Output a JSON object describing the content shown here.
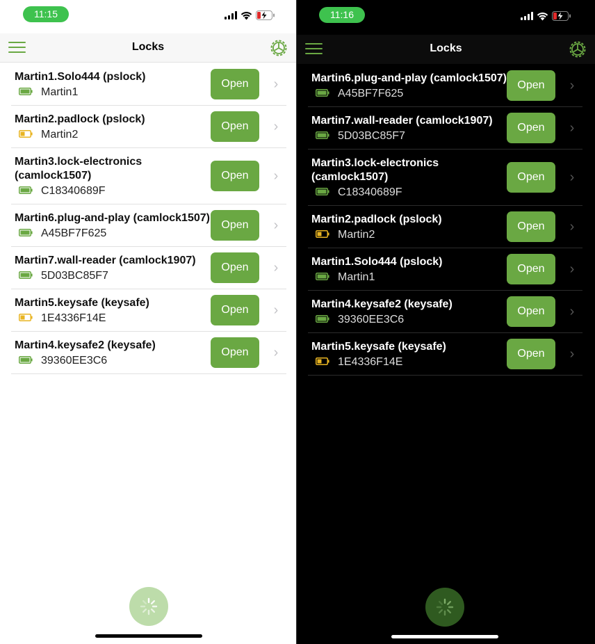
{
  "colors": {
    "accent": "#6aa843",
    "battery_ok": "#6aa843",
    "battery_low": "#e8b422",
    "time_pill": "#3ec24e"
  },
  "light": {
    "status": {
      "time": "11:15"
    },
    "nav": {
      "title": "Locks",
      "menu_icon": "hamburger-menu-icon",
      "settings_icon": "gear-icon"
    },
    "locks": [
      {
        "name": "Martin1.Solo444 (pslock)",
        "subtitle": "Martin1",
        "battery": "ok",
        "action": "Open"
      },
      {
        "name": "Martin2.padlock (pslock)",
        "subtitle": "Martin2",
        "battery": "low",
        "action": "Open"
      },
      {
        "name": "Martin3.lock-electronics (camlock1507)",
        "subtitle": "C18340689F",
        "battery": "ok",
        "action": "Open"
      },
      {
        "name": "Martin6.plug-and-play (camlock1507)",
        "subtitle": "A45BF7F625",
        "battery": "ok",
        "action": "Open"
      },
      {
        "name": "Martin7.wall-reader (camlock1907)",
        "subtitle": "5D03BC85F7",
        "battery": "ok",
        "action": "Open"
      },
      {
        "name": "Martin5.keysafe (keysafe)",
        "subtitle": "1E4336F14E",
        "battery": "low",
        "action": "Open"
      },
      {
        "name": "Martin4.keysafe2 (keysafe)",
        "subtitle": "39360EE3C6",
        "battery": "ok",
        "action": "Open"
      }
    ]
  },
  "dark": {
    "status": {
      "time": "11:16"
    },
    "nav": {
      "title": "Locks",
      "menu_icon": "hamburger-menu-icon",
      "settings_icon": "gear-icon"
    },
    "locks": [
      {
        "name": "Martin6.plug-and-play (camlock1507)",
        "subtitle": "A45BF7F625",
        "battery": "ok",
        "action": "Open"
      },
      {
        "name": "Martin7.wall-reader (camlock1907)",
        "subtitle": "5D03BC85F7",
        "battery": "ok",
        "action": "Open"
      },
      {
        "name": "Martin3.lock-electronics (camlock1507)",
        "subtitle": "C18340689F",
        "battery": "ok",
        "action": "Open"
      },
      {
        "name": "Martin2.padlock (pslock)",
        "subtitle": "Martin2",
        "battery": "low",
        "action": "Open"
      },
      {
        "name": "Martin1.Solo444 (pslock)",
        "subtitle": "Martin1",
        "battery": "ok",
        "action": "Open"
      },
      {
        "name": "Martin4.keysafe2 (keysafe)",
        "subtitle": "39360EE3C6",
        "battery": "ok",
        "action": "Open"
      },
      {
        "name": "Martin5.keysafe (keysafe)",
        "subtitle": "1E4336F14E",
        "battery": "low",
        "action": "Open"
      }
    ]
  }
}
